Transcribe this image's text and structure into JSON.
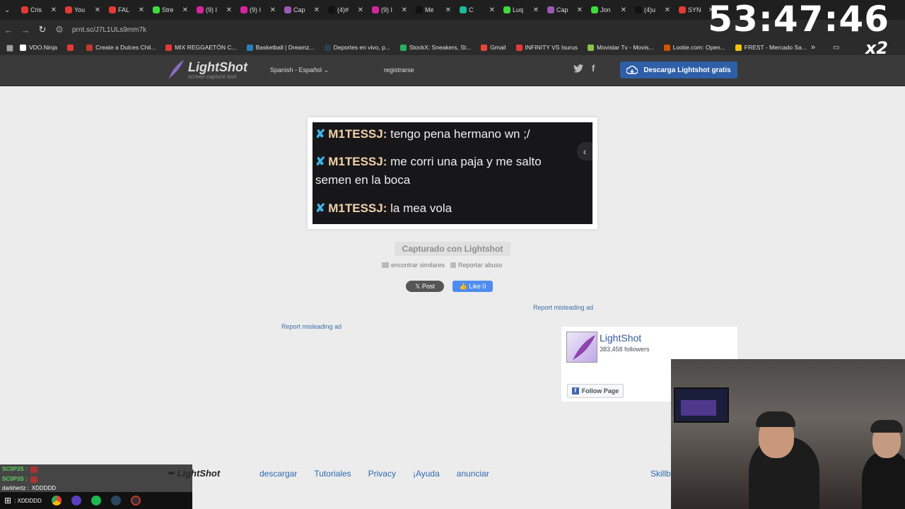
{
  "browser": {
    "tabs": [
      {
        "label": "Cris",
        "color": "#e53935"
      },
      {
        "label": "You",
        "color": "#e53935"
      },
      {
        "label": "FAL",
        "color": "#e53935"
      },
      {
        "label": "Stre",
        "color": "#3ddc3d"
      },
      {
        "label": "(9) I",
        "color": "#d6249f"
      },
      {
        "label": "(9) I",
        "color": "#d6249f"
      },
      {
        "label": "Cap",
        "color": "#9b59b6"
      },
      {
        "label": "(4)#",
        "color": "#111111"
      },
      {
        "label": "(9) I",
        "color": "#d6249f"
      },
      {
        "label": "Me",
        "color": "#111111"
      },
      {
        "label": "C",
        "color": "#1abc9c"
      },
      {
        "label": "Luq",
        "color": "#3ddc3d"
      },
      {
        "label": "Cap",
        "color": "#9b59b6"
      },
      {
        "label": "Jon",
        "color": "#3ddc3d"
      },
      {
        "label": "(4)u",
        "color": "#111111"
      },
      {
        "label": "SYN",
        "color": "#e53935"
      }
    ],
    "url": "prnt.sc/J7L1ULs9mm7k",
    "bookmarks": [
      {
        "label": "VDO.Ninja",
        "color": "#ffffff"
      },
      {
        "label": "",
        "color": "#e53935"
      },
      {
        "label": "Create a Dulces Chil...",
        "color": "#c0392b"
      },
      {
        "label": "MIX REGGAETÓN C...",
        "color": "#e53935"
      },
      {
        "label": "Basketball | Dreamz...",
        "color": "#2980b9"
      },
      {
        "label": "Deportes en vivo, p...",
        "color": "#2c3e50"
      },
      {
        "label": "StockX: Sneakers, St...",
        "color": "#27ae60"
      },
      {
        "label": "Gmail",
        "color": "#ea4335"
      },
      {
        "label": "INFINITY VS Isurus",
        "color": "#e53935"
      },
      {
        "label": "Movistar Tv - Movis...",
        "color": "#8bc34a"
      },
      {
        "label": "Lootie.com: Open...",
        "color": "#d35400"
      },
      {
        "label": "FREST - Mercado Sa...",
        "color": "#f1c40f"
      }
    ]
  },
  "overlay": {
    "timer": "53:47:46",
    "multiplier": "x2"
  },
  "header": {
    "logo_title": "LightShot",
    "logo_sub": "screen capture tool",
    "language": "Spanish - Español",
    "register": "registrarse",
    "download": "Descarga Lightshot gratis"
  },
  "screenshot": {
    "messages": [
      {
        "name": "M1TESSJ:",
        "text": " tengo pena hermano wn ;/"
      },
      {
        "name": "M1TESSJ:",
        "text": " me corri una paja y me salto"
      },
      {
        "name": "",
        "text": "semen en la boca"
      },
      {
        "name": "M1TESSJ:",
        "text": " la mea vola"
      }
    ]
  },
  "caption": "Capturado con Lightshot",
  "actions": {
    "similar": "encontrar similares",
    "report": "Reportar abuso",
    "post": "Post",
    "like": "Like 0",
    "ad_report_1": "Report misleading ad",
    "ad_report_2": "Report misleading ad"
  },
  "fb": {
    "name": "LightShot",
    "followers": "383,458 followers",
    "follow": "Follow Page"
  },
  "footer": {
    "logo": "LightShot",
    "links": [
      "descargar",
      "Tutoriales",
      "Privacy",
      "¡Ayuda",
      "anunciar"
    ],
    "skill": "Skillb"
  },
  "stream_chat": [
    {
      "user": "SC0P3S :",
      "text": ""
    },
    {
      "user": "SC0P3S :",
      "text": ""
    },
    {
      "user": "darkhertz :",
      "text": "XDDDDD"
    },
    {
      "user": "",
      "text": ": XDDDDD"
    }
  ]
}
